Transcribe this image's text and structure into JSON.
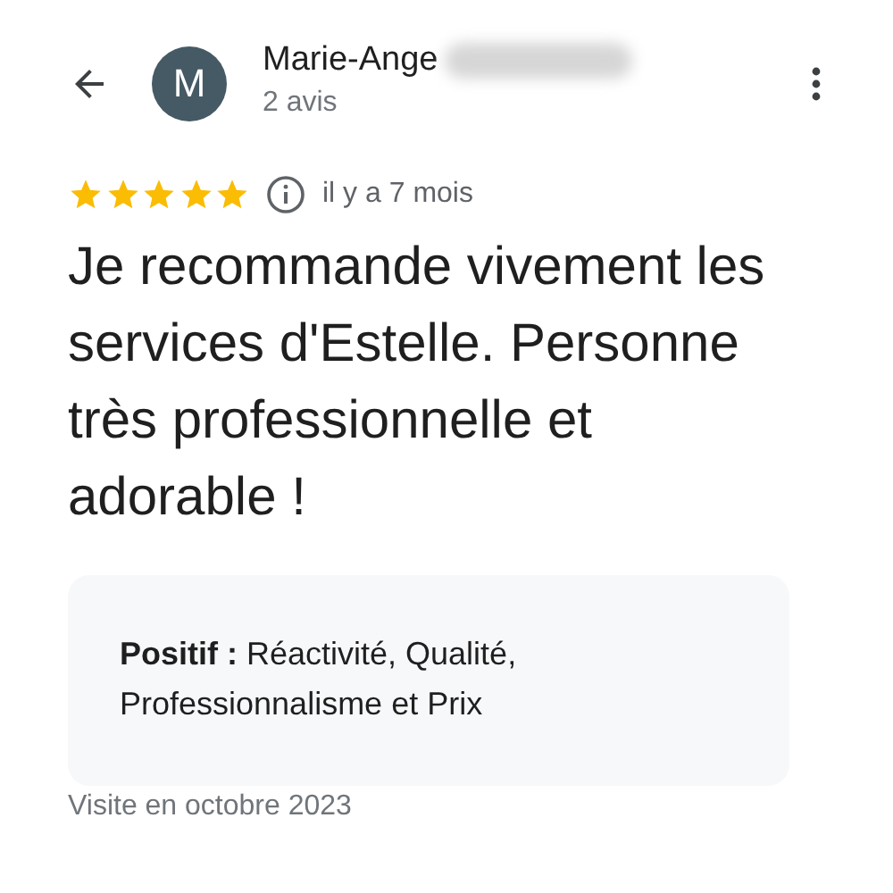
{
  "reviewer": {
    "initial": "M",
    "name": "Marie-Ange",
    "review_count": "2 avis"
  },
  "review": {
    "stars": 5,
    "time": "il y a 7 mois",
    "text": "Je recommande vivement les services d'Estelle. Personne très professionnelle et adorable !"
  },
  "highlights": "**Positif :** Réactivité, Qualité, Professionnalisme et Prix",
  "visit": "Visite en octobre 2023"
}
